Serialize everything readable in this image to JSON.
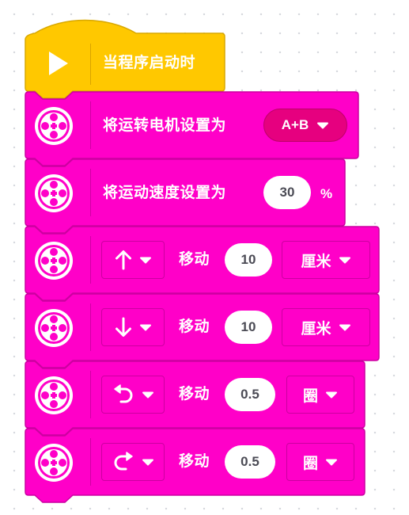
{
  "hat_block": {
    "label": "当程序启动时",
    "icon": "play-icon",
    "color": "#ffc800"
  },
  "blocks": [
    {
      "label": "将运转电机设置为",
      "port_value": "A+B",
      "icon": "motor-icon"
    },
    {
      "label": "将运动速度设置为",
      "value": "30",
      "unit": "%",
      "icon": "motor-icon"
    },
    {
      "direction_icon": "arrow-up-icon",
      "label": "移动",
      "value": "10",
      "unit": "厘米"
    },
    {
      "direction_icon": "arrow-down-icon",
      "label": "移动",
      "value": "10",
      "unit": "厘米"
    },
    {
      "direction_icon": "turn-left-icon",
      "label": "移动",
      "value": "0.5",
      "unit": "圈"
    },
    {
      "direction_icon": "turn-right-icon",
      "label": "移动",
      "value": "0.5",
      "unit": "圈"
    }
  ],
  "colors": {
    "movement": "#ff00c8",
    "movement_border": "#cc00a0",
    "events": "#ffc800",
    "field_text": "#4b4b55"
  }
}
